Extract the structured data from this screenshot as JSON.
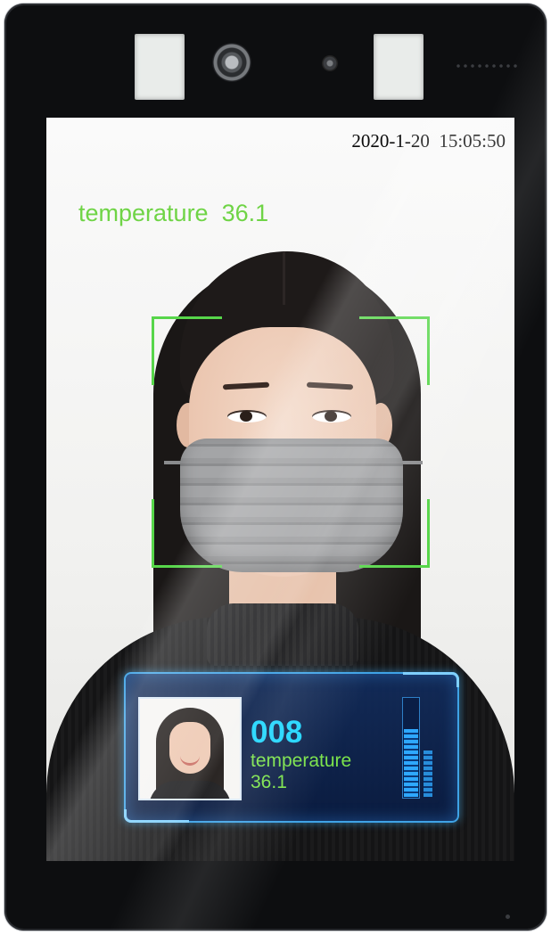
{
  "screen": {
    "datetime": "2020-1-20  15:05:50",
    "temperature_label": "temperature",
    "temperature_value": "36.1",
    "face_frame_color": "#57d64a"
  },
  "result_card": {
    "id": "008",
    "temperature_label": "temperature",
    "temperature_value": "36.1",
    "level_fraction": 0.7,
    "accent_color": "#1fd6ff",
    "text_color": "#7be34b"
  },
  "icons": [
    "camera-icon",
    "ir-sensor-icon",
    "speaker-grille-icon"
  ]
}
